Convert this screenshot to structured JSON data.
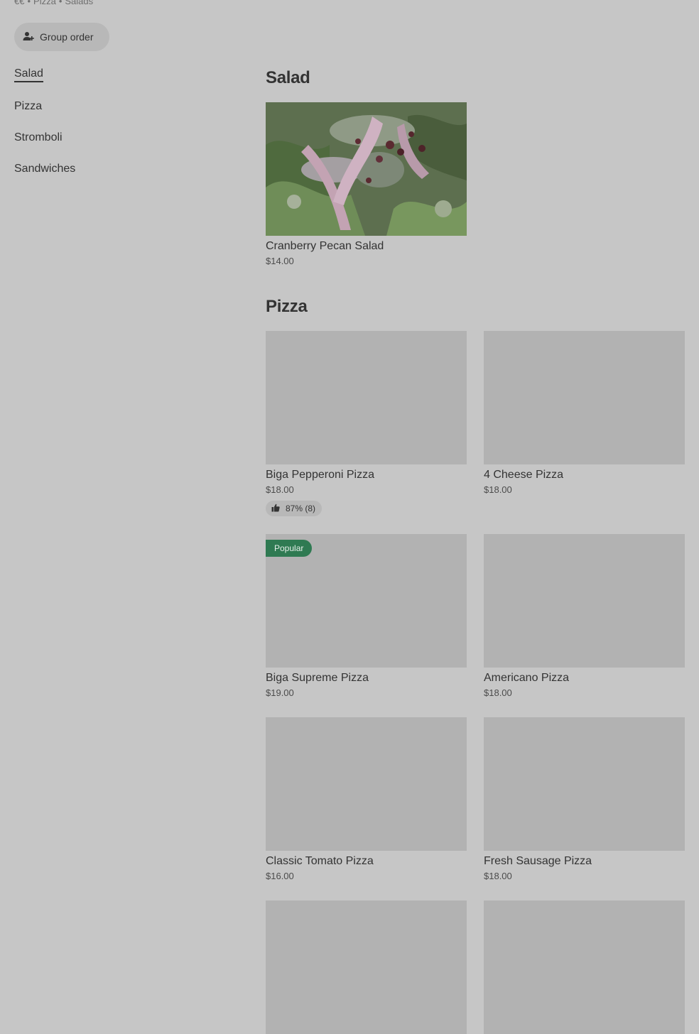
{
  "store": {
    "meta": [
      "€€",
      "Pizza",
      "Salads"
    ],
    "group_order_label": "Group order"
  },
  "nav": {
    "items": [
      {
        "label": "Salad",
        "active": true
      },
      {
        "label": "Pizza",
        "active": false
      },
      {
        "label": "Stromboli",
        "active": false
      },
      {
        "label": "Sandwiches",
        "active": false
      }
    ]
  },
  "sections": {
    "salad": {
      "title": "Salad",
      "items": [
        {
          "name": "Cranberry Pecan Salad",
          "price": "$14.00"
        }
      ]
    },
    "pizza": {
      "title": "Pizza",
      "items": [
        {
          "name": "Biga Pepperoni Pizza",
          "price": "$18.00",
          "rating": "87% (8)"
        },
        {
          "name": "4 Cheese Pizza",
          "price": "$18.00"
        },
        {
          "name": "Biga Supreme Pizza",
          "price": "$19.00",
          "badge": "Popular"
        },
        {
          "name": "Americano Pizza",
          "price": "$18.00"
        },
        {
          "name": "Classic Tomato Pizza",
          "price": "$16.00"
        },
        {
          "name": "Fresh Sausage Pizza",
          "price": "$18.00"
        }
      ]
    }
  },
  "icons": {
    "group_order": "person-plus-icon",
    "rating": "thumbs-up-icon"
  },
  "colors": {
    "background": "#c6c6c6",
    "placeholder": "#b2b2b2",
    "popular_badge": "#2f7a52"
  }
}
